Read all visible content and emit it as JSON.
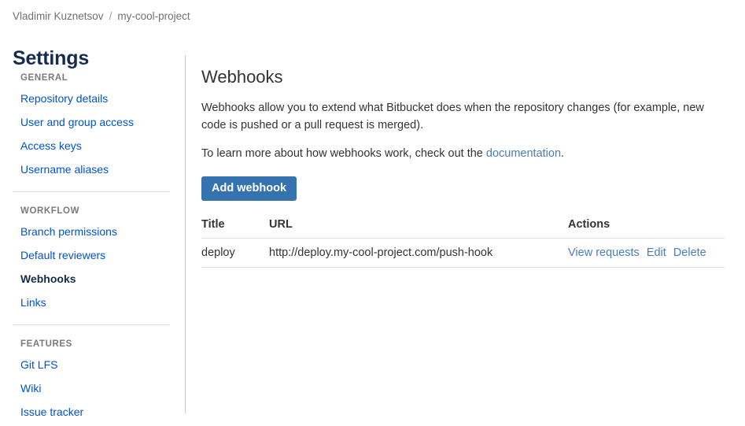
{
  "breadcrumb": {
    "owner": "Vladimir Kuznetsov",
    "separator": "/",
    "repo": "my-cool-project"
  },
  "page_title": "Settings",
  "sidebar": {
    "groups": [
      {
        "heading": "GENERAL",
        "items": [
          {
            "label": "Repository details",
            "active": false
          },
          {
            "label": "User and group access",
            "active": false
          },
          {
            "label": "Access keys",
            "active": false
          },
          {
            "label": "Username aliases",
            "active": false
          }
        ]
      },
      {
        "heading": "WORKFLOW",
        "items": [
          {
            "label": "Branch permissions",
            "active": false
          },
          {
            "label": "Default reviewers",
            "active": false
          },
          {
            "label": "Webhooks",
            "active": true
          },
          {
            "label": "Links",
            "active": false
          }
        ]
      },
      {
        "heading": "FEATURES",
        "items": [
          {
            "label": "Git LFS",
            "active": false
          },
          {
            "label": "Wiki",
            "active": false
          },
          {
            "label": "Issue tracker",
            "active": false
          }
        ]
      }
    ]
  },
  "main": {
    "title": "Webhooks",
    "paragraph1": "Webhooks allow you to extend what Bitbucket does when the repository changes (for example, new code is pushed or a pull request is merged).",
    "paragraph2_prefix": "To learn more about how webhooks work, check out the ",
    "paragraph2_link": "documentation",
    "paragraph2_suffix": ".",
    "add_webhook_label": "Add webhook",
    "table": {
      "columns": [
        "Title",
        "URL",
        "Actions"
      ],
      "rows": [
        {
          "title": "deploy",
          "url": "http://deploy.my-cool-project.com/push-hook",
          "actions": [
            "View requests",
            "Edit",
            "Delete"
          ]
        }
      ]
    }
  },
  "colors": {
    "link": "#0052cc",
    "content_link": "#4a7ebb",
    "button": "#3572b0",
    "heading": "#172b4d",
    "muted": "#7a7a7a",
    "border": "#dddddd"
  }
}
